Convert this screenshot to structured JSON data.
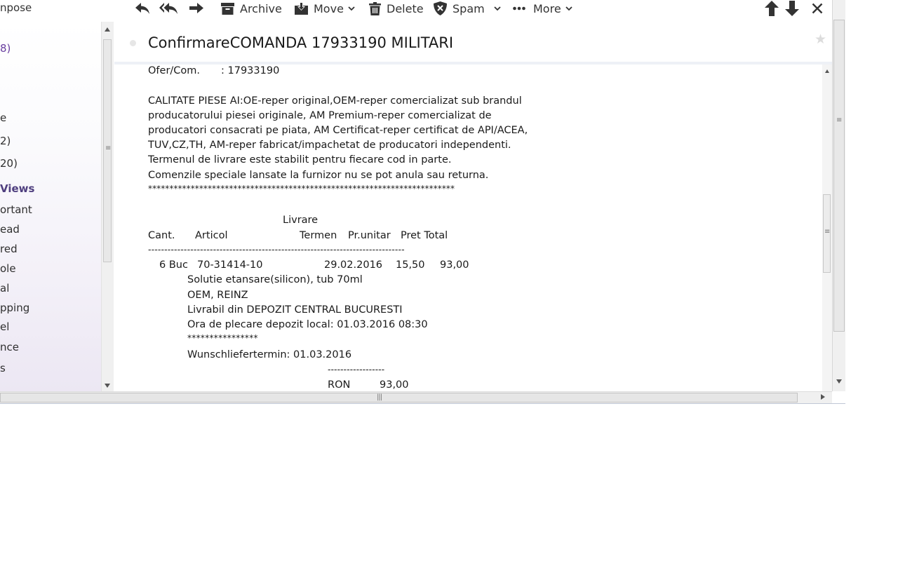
{
  "toolbar": {
    "archive_label": "Archive",
    "move_label": "Move",
    "delete_label": "Delete",
    "spam_label": "Spam",
    "more_label": "More"
  },
  "sidebar": {
    "compose": "npose",
    "items": [
      "8)",
      "e",
      "2)",
      "20)",
      "Views",
      "ortant",
      "ead",
      "red",
      "ole",
      "al",
      "pping",
      "el",
      "nce",
      "s"
    ]
  },
  "message": {
    "subject": "ConfirmareCOMANDA 17933190 MILITARI",
    "ofer_label": "Ofer/Com.",
    "ofer_value": ": 17933190",
    "quality_lines": [
      "CALITATE PIESE AI:OE-reper original,OEM-reper comercializat sub brandul",
      "producatorului piesei originale, AM Premium-reper comercializat de",
      "producatori consacrati pe piata, AM Certificat-reper certificat de API/ACEA,",
      "TUV,CZ,TH, AM-reper fabricat/impachetat de producatori independenti.",
      "Termenul de livrare este stabilit pentru fiecare cod in parte.",
      "Comenzile speciale lansate la furnizor nu se pot anula sau returna."
    ],
    "star_separator": "************************************************************************",
    "table_header": {
      "livrare": "Livrare",
      "cant": "Cant.",
      "articol": "Articol",
      "termen": "Termen",
      "pr_unitar": "Pr.unitar",
      "pret_total": "Pret Total"
    },
    "dash_separator": "-------------------------------------------------------------------------------",
    "row": {
      "qty": "6 Buc",
      "code": "70-31414-10",
      "date": "29.02.2016",
      "unit_price": "15,50",
      "total": "93,00"
    },
    "detail_lines": [
      "Solutie etansare(silicon), tub 70ml",
      "OEM, REINZ",
      "Livrabil din DEPOZIT CENTRAL BUCURESTI",
      "Ora de plecare depozit local: 01.03.2016 08:30"
    ],
    "short_stars": "****************",
    "wunsch": "Wunschliefertermin: 01.03.2016",
    "short_dashes": "------------------",
    "currency": "RON",
    "sum": "93,00"
  }
}
